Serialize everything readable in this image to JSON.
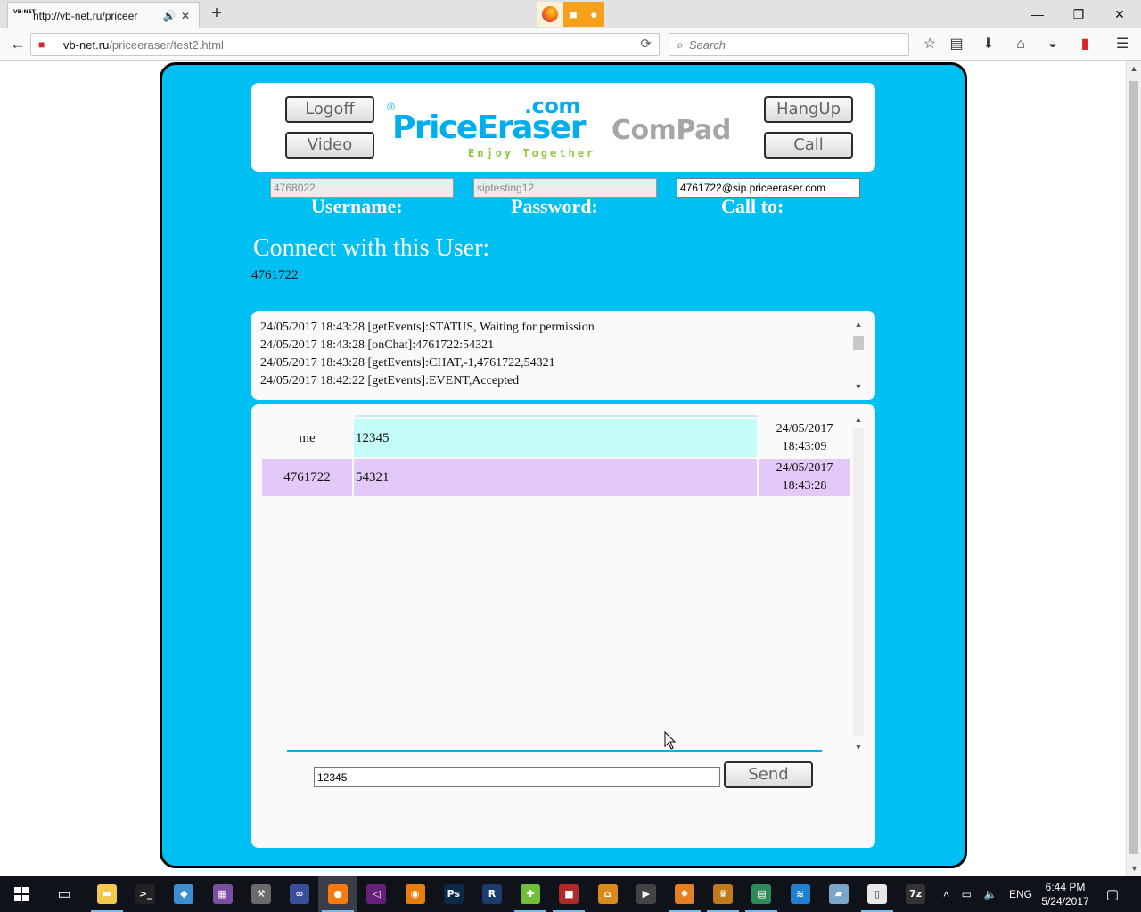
{
  "browser": {
    "tab": {
      "favicon_text": "VB·NET",
      "title": "http://vb-net.ru/priceer"
    },
    "url": {
      "host": "vb-net.ru",
      "path": "/priceeraser/test2.html"
    },
    "search_placeholder": "Search",
    "window_controls": [
      "—",
      "❐",
      "✕"
    ]
  },
  "page": {
    "buttons": {
      "logoff": "Logoff",
      "video": "Video",
      "hangup": "HangUp",
      "call": "Call",
      "send": "Send"
    },
    "logo": {
      "registered": "®",
      "com": ".com",
      "brand": "PriceEraser",
      "tagline": "Enjoy Together",
      "product": "ComPad"
    },
    "fields": {
      "username_value": "4768022",
      "password_value": "siptesting12",
      "callto_value": "4761722@sip.priceeraser.com",
      "username_label": "Username:",
      "password_label": "Password:",
      "callto_label": "Call to:"
    },
    "connect": {
      "title": "Connect with this User:",
      "user": "4761722"
    },
    "log_lines": [
      "24/05/2017 18:43:28 [getEvents]:STATUS, Waiting for permission",
      "24/05/2017 18:43:28 [onChat]:4761722:54321",
      "24/05/2017 18:43:28 [getEvents]:CHAT,-1,4761722,54321",
      "24/05/2017 18:42:22 [getEvents]:EVENT,Accepted"
    ],
    "chat": [
      {
        "name": "me",
        "message": "12345",
        "date": "24/05/2017",
        "time": "18:43:09"
      },
      {
        "name": "4761722",
        "message": "54321",
        "date": "24/05/2017",
        "time": "18:43:28"
      }
    ],
    "message_input_value": "12345"
  },
  "taskbar": {
    "language": "ENG",
    "time": "6:44 PM",
    "date": "5/24/2017",
    "colors": {
      "frame": "#00bff3",
      "brand": "#00aeef",
      "tagline": "#8dc63f",
      "me_row": "#c4fcfa",
      "other_row": "#e3c9f7"
    },
    "apps": [
      {
        "icon": "file-explorer-icon",
        "glyph": "▬",
        "bg": "#f2c94c"
      },
      {
        "icon": "command-prompt-icon",
        "glyph": ">_",
        "bg": "#222222"
      },
      {
        "icon": "control-panel-icon",
        "glyph": "◆",
        "bg": "#3b8ed0"
      },
      {
        "icon": "winrar-icon",
        "glyph": "▦",
        "bg": "#7b4fa0"
      },
      {
        "icon": "tools-icon",
        "glyph": "⚒",
        "bg": "#6b6b6b"
      },
      {
        "icon": "infinity-icon",
        "glyph": "∞",
        "bg": "#3a4f9a"
      },
      {
        "icon": "firefox-icon",
        "glyph": "●",
        "bg": "#f77a0f"
      },
      {
        "icon": "visual-studio-icon",
        "glyph": "◁",
        "bg": "#68217a"
      },
      {
        "icon": "blender-icon",
        "glyph": "◉",
        "bg": "#e87d0d"
      },
      {
        "icon": "photoshop-icon",
        "glyph": "Ps",
        "bg": "#0b2a4a"
      },
      {
        "icon": "r-icon",
        "glyph": "R",
        "bg": "#1c3b6e"
      },
      {
        "icon": "puzzle-icon",
        "glyph": "✚",
        "bg": "#6fbf3a"
      },
      {
        "icon": "save-disk-icon",
        "glyph": "■",
        "bg": "#b02a2a"
      },
      {
        "icon": "house-icon",
        "glyph": "⌂",
        "bg": "#d98a1c"
      },
      {
        "icon": "clapper-icon",
        "glyph": "▶",
        "bg": "#444444"
      },
      {
        "icon": "sun-icon",
        "glyph": "✹",
        "bg": "#e67e22"
      },
      {
        "icon": "crown-icon",
        "glyph": "♛",
        "bg": "#c07a1c"
      },
      {
        "icon": "chart-icon",
        "glyph": "▤",
        "bg": "#2e8b57"
      },
      {
        "icon": "swift-icon",
        "glyph": "≋",
        "bg": "#1f7fd0"
      },
      {
        "icon": "pad-icon",
        "glyph": "▰",
        "bg": "#7aa7c7"
      },
      {
        "icon": "document-icon",
        "glyph": "▯",
        "bg": "#e8e8e8"
      },
      {
        "icon": "7zip-icon",
        "glyph": "7z",
        "bg": "#333333"
      }
    ]
  }
}
